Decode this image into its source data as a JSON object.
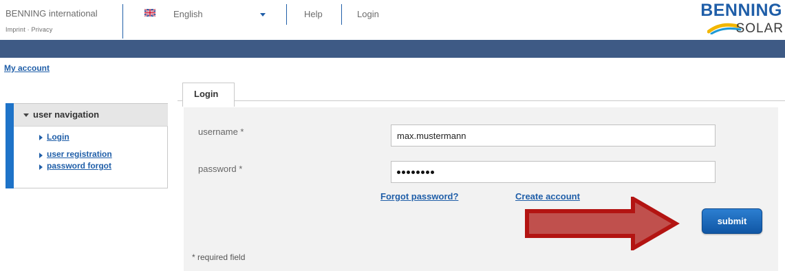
{
  "header": {
    "company": "BENNING international",
    "imprint": "Imprint",
    "separator": "·",
    "privacy": "Privacy",
    "language": "English",
    "help": "Help",
    "login": "Login",
    "logo_top": "BENNING",
    "logo_bottom": "SOLAR"
  },
  "breadcrumb": {
    "my_account": "My account"
  },
  "sidebar": {
    "title": "user navigation",
    "items": [
      {
        "label": "Login"
      },
      {
        "label": "user registration"
      },
      {
        "label": "password forgot"
      }
    ]
  },
  "main": {
    "tab": "Login",
    "username_label": "username *",
    "username_value": "max.mustermann",
    "password_label": "password *",
    "password_masked": "••••••••",
    "forgot_password": "Forgot password?",
    "create_account": "Create account",
    "submit": "submit",
    "required_note": "* required field"
  },
  "colors": {
    "brand_blue": "#1f5ea8",
    "topbar": "#3e5a85",
    "annotation_arrow": "#c0504d"
  }
}
